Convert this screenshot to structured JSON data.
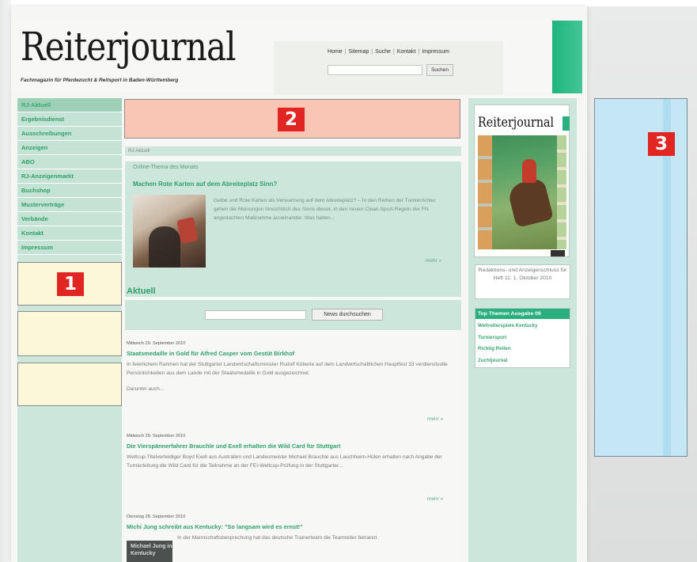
{
  "site": {
    "logo": "Reiterjournal",
    "tagline": "Fachmagazin für Pferdezucht & Reitsport in Baden-Württemberg"
  },
  "header_nav": {
    "links": [
      "Home",
      "Sitemap",
      "Suche",
      "Kontakt",
      "Impressum"
    ],
    "search_placeholder": "",
    "search_button": "Suchen"
  },
  "left_menu": {
    "items": [
      "RJ-Aktuell",
      "Ergebnisdienst",
      "Ausschreibungen",
      "Anzeigen",
      "ABO",
      "RJ-Anzeigenmarkt",
      "Buchshop",
      "Musterverträge",
      "Verbände",
      "Kontakt",
      "Impressum"
    ]
  },
  "badges": [
    "1",
    "2",
    "3"
  ],
  "breadcrumb": "RJ-Aktuell",
  "theme_of_month": {
    "header": "Online-Thema des Monats",
    "title": "Machen Rote Karten auf dem Abreiteplatz Sinn?",
    "text": "Gelbe und Rote Karten als Verwarnung auf dem Abreiteplatz? – In den Reihen der Turnierrichter gehen die Meinungen hinsichtlich des Sinns dieser, in den neuen Clean-Sport-Regeln der FN angedachten Maßnahme auseinander. Was halten...",
    "more": "mehr »"
  },
  "aktuell": {
    "heading": "Aktuell",
    "search_placeholder": "",
    "search_button": "News durchsuchen"
  },
  "articles": [
    {
      "date": "Mittwoch 29. September 2010",
      "title": "Staatsmedaille in Gold für Alfred Casper vom Gestüt Birkhof",
      "body": "In feierlichem Rahmen hat der Stuttgarter Landwirtschaftsminister Rudolf Köberle auf dem Landwirtschaftlichen Hauptfest 33 verdienstvolle Persönlichkeiten aus dem Lande mit der Staatsmedaille in Gold ausgezeichnet.",
      "body2": "Darunter auch...",
      "more": "mehr »"
    },
    {
      "date": "Mittwoch 29. September 2010",
      "title": "Die Vierspännerfahrer Brauchle und Exell erhalten die Wild Card für Stuttgart",
      "body": "Weltcup-Titelverteidiger Boyd Exell aus Australien und Landesmeister Michael Brauchle aus Lauchheim-Hülen erhalten nach Angabe der Turnierleitung die Wild Card für die Teilnahme an der FEI-Weltcup-Prüfung in der Stuttgarter...",
      "more": "mehr »"
    },
    {
      "date": "Dienstag 28. September 2010",
      "title": "Michi Jung schreibt aus Kentucky: \"So langsam wird es ernst!\"",
      "body": "In der Mannschaftsbesprechung hat das deutsche Trainerteam die Teamreiter benannt",
      "image_caption": "Michael Jung in Kentucky"
    }
  ],
  "right_col": {
    "cover_title": "Reiterjournal",
    "redaktion": "Redaktions- und Anzeigenschluss für Heft 11: 1. Oktober 2010",
    "top_themen_header": "Top Themen Ausgabe 09",
    "top_themen": [
      "Weltreiterspiele Kentucky",
      "Turniersport",
      "Richtig Reiten",
      "Zuchtjournal"
    ]
  },
  "colors": {
    "accent_green": "#2e9f6b",
    "panel_green": "#cde6db",
    "ad_yellow": "#fdf7d9",
    "ad_salmon": "#f9c6b5",
    "ad_blue": "#c4e6f5",
    "badge_red": "#e02522"
  }
}
